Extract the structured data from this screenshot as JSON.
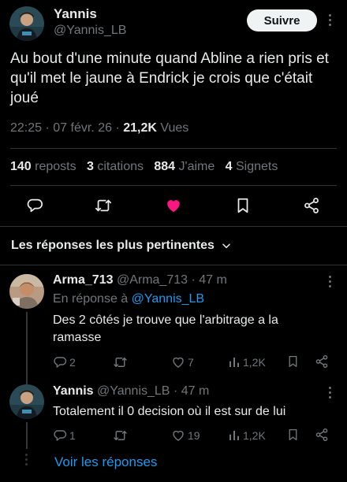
{
  "tweet": {
    "author_name": "Yannis",
    "author_handle": "@Yannis_LB",
    "follow_label": "Suivre",
    "text": "Au bout d'une minute quand Abline a rien pris et qu'il met le jaune à Endrick je crois que c'était joué",
    "time": "22:25",
    "date": "07 févr. 26",
    "views_count": "21,2K",
    "views_label": "Vues",
    "reposts_count": "140",
    "reposts_label": "reposts",
    "quotes_count": "3",
    "quotes_label": "citations",
    "likes_count": "884",
    "likes_label": "J'aime",
    "bookmarks_count": "4",
    "bookmarks_label": "Signets"
  },
  "replies_header": {
    "label": "Les réponses les plus pertinentes"
  },
  "replies": [
    {
      "name": "Arma_713",
      "handle": "@Arma_713",
      "time": "47 m",
      "in_reply_prefix": "En réponse à",
      "in_reply_to": "@Yannis_LB",
      "text": "Des 2 côtés je trouve que l'arbitrage a la ramasse",
      "reply_count": "2",
      "repost_count": "",
      "like_count": "7",
      "views": "1,2K"
    },
    {
      "name": "Yannis",
      "handle": "@Yannis_LB",
      "time": "47 m",
      "text": "Totalement il 0 decision où il est sur de lui",
      "reply_count": "1",
      "repost_count": "",
      "like_count": "19",
      "views": "1,2K"
    }
  ],
  "show_replies_label": "Voir les réponses",
  "colors": {
    "background": "#000000",
    "text": "#e7e9ea",
    "muted": "#71767b",
    "accent": "#1d9bf0",
    "like_active": "#f91880"
  },
  "icons": {
    "reply": "reply-icon",
    "repost": "repost-icon",
    "like": "heart-icon",
    "bookmark": "bookmark-icon",
    "share": "share-icon",
    "views": "views-icon",
    "more": "more-icon",
    "chevron": "chevron-down-icon"
  }
}
